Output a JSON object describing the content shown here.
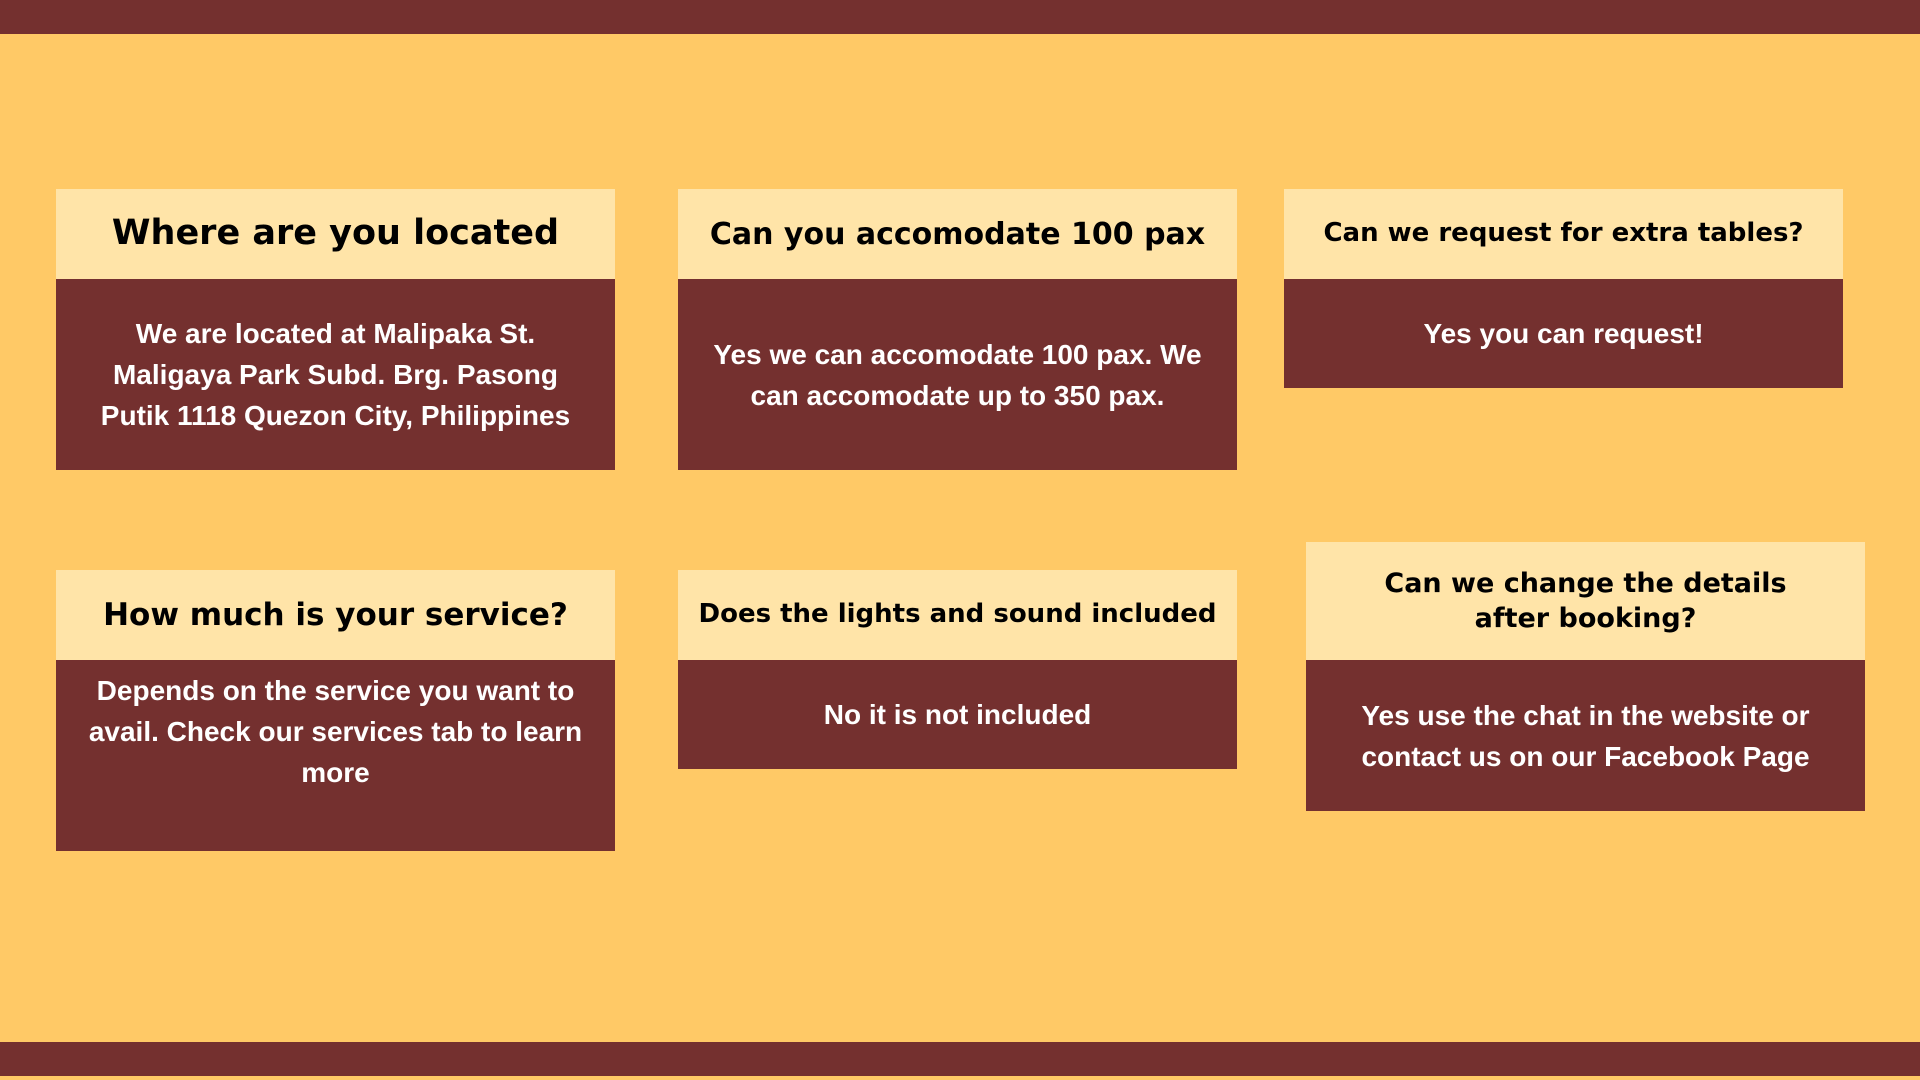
{
  "colors": {
    "background": "#FFC966",
    "band": "#74302F",
    "question_bg": "#FFE4A8",
    "answer_bg": "#74302F",
    "question_text": "#000000",
    "answer_text": "#FFFFFF"
  },
  "faq": [
    {
      "question": "Where are you located",
      "answer": "We are located at Malipaka St. Maligaya Park Subd. Brg. Pasong Putik 1118 Quezon City, Philippines"
    },
    {
      "question": "Can you accomodate 100 pax",
      "answer": "Yes we can accomodate 100 pax. We can accomodate up to 350 pax."
    },
    {
      "question": "Can we request for extra tables?",
      "answer": "Yes you can request!"
    },
    {
      "question": "How much is your service?",
      "answer": "Depends on the service you want to avail. Check our services tab to learn more"
    },
    {
      "question": "Does the lights and sound included",
      "answer": "No it is not included"
    },
    {
      "question": "Can we change the details after booking?",
      "answer": "Yes use the chat in the website or contact us on our Facebook Page"
    }
  ]
}
